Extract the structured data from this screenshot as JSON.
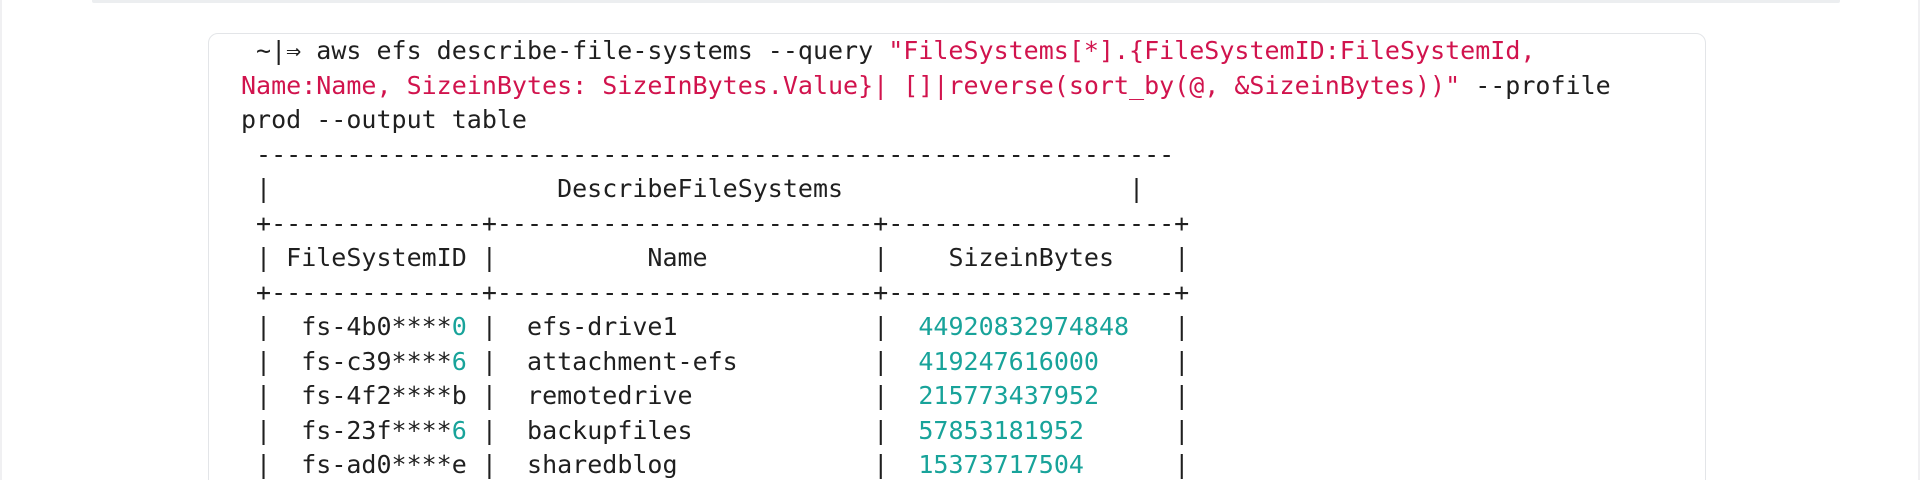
{
  "command": {
    "prompt": " ~|⇒ ",
    "cmd": "aws efs describe-file-systems --query ",
    "query_part1": "\"FileSystems[*].{FileSystemID:FileSystemId,",
    "query_part2": "Name:Name, SizeinBytes: SizeInBytes.Value}| []|reverse(sort_by(@, &SizeinBytes))\"",
    "profile_flag": " --profile",
    "line3": "prod --output table"
  },
  "table": {
    "top_border": " -------------------------------------------------------------",
    "title_left": " |                   ",
    "title": "DescribeFileSystems",
    "title_right": "                   |",
    "separator": " +--------------+-------------------------+-------------------+",
    "header_left": " | ",
    "headers": {
      "id": "FileSystemID",
      "name": "Name",
      "size": "SizeinBytes"
    },
    "rows": [
      {
        "id_prefix": "fs-4b0****",
        "id_suffix": "0",
        "id_suffix_colored": true,
        "name": "efs-drive1",
        "size": "44920832974848"
      },
      {
        "id_prefix": "fs-c39****",
        "id_suffix": "6",
        "id_suffix_colored": true,
        "name": "attachment-efs",
        "size": "419247616000"
      },
      {
        "id_prefix": "fs-4f2****",
        "id_suffix": "b",
        "id_suffix_colored": false,
        "name": "remotedrive",
        "size": "215773437952"
      },
      {
        "id_prefix": "fs-23f****",
        "id_suffix": "6",
        "id_suffix_colored": true,
        "name": "backupfiles",
        "size": "57853181952"
      },
      {
        "id_prefix": "fs-ad0****",
        "id_suffix": "e",
        "id_suffix_colored": false,
        "name": "sharedblog",
        "size": "15373717504"
      }
    ]
  },
  "colors": {
    "string": "#d1134d",
    "number": "#18a39a",
    "text": "#1f1f1f",
    "border": "#e3e5e8"
  }
}
